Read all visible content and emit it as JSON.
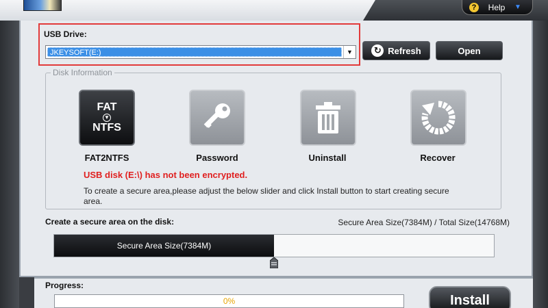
{
  "header": {
    "help_label": "Help"
  },
  "usb": {
    "label": "USB Drive:",
    "selected": "JKEYSOFT(E:)",
    "refresh_label": "Refresh",
    "open_label": "Open"
  },
  "disk_info": {
    "title": "Disk Information",
    "tools": [
      {
        "label": "FAT2NTFS",
        "icon_line1": "FAT",
        "icon_line2": "NTFS",
        "icon": "fat-to-ntfs-icon"
      },
      {
        "label": "Password",
        "icon": "key-icon"
      },
      {
        "label": "Uninstall",
        "icon": "trash-icon"
      },
      {
        "label": "Recover",
        "icon": "recover-icon"
      }
    ],
    "warning": "USB disk (E:\\) has not been encrypted.",
    "hint": "To create a secure area,please adjust the below slider and click Install button to start creating secure area."
  },
  "secure_area": {
    "title": "Create a secure area on the disk:",
    "sizes": "Secure Area Size(7384M) / Total Size(14768M)",
    "slider_label": "Secure Area Size(7384M)",
    "slider_fraction": 0.5
  },
  "progress": {
    "label": "Progress:",
    "value_text": "0%",
    "value": 0
  },
  "install_label": "Install",
  "colors": {
    "accent_red": "#e23a3a",
    "warning_red": "#e01f1f",
    "selection_blue": "#3b8fe6",
    "progress_text": "#e8a400"
  }
}
